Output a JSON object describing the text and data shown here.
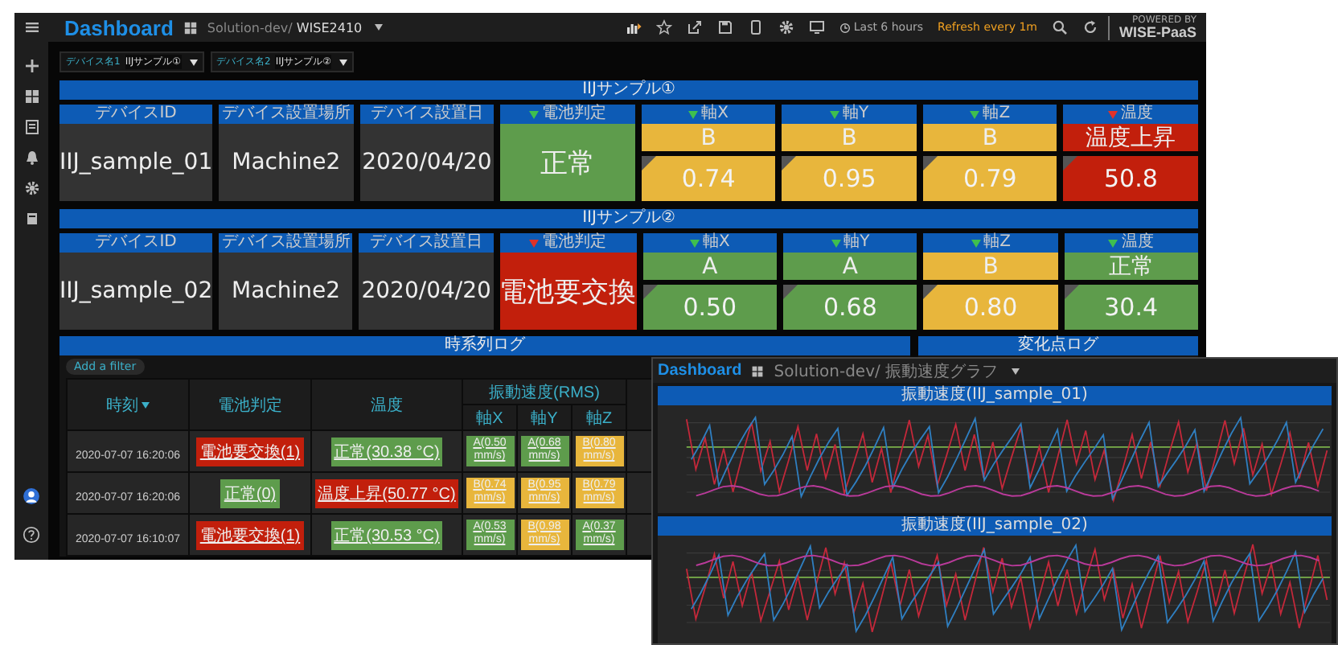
{
  "main": {
    "topbar": {
      "title": "Dashboard",
      "folder": "Solution-dev/",
      "name": "WISE2410",
      "time_range": "Last 6 hours",
      "refresh": "Refresh every 1m",
      "powered_by": "POWERED BY",
      "brand": "WISE-PaaS"
    },
    "variables": [
      {
        "label": "デバイス名1",
        "value": "IIJサンプル①"
      },
      {
        "label": "デバイス名2",
        "value": "IIJサンプル②"
      }
    ],
    "devices": [
      {
        "title": "IIJサンプル①",
        "fields": [
          {
            "label": "デバイスID",
            "value": "IIJ_sample_01"
          },
          {
            "label": "デバイス設置場所",
            "value": "Machine2"
          },
          {
            "label": "デバイス設置日",
            "value": "2020/04/20"
          }
        ],
        "battery": {
          "label": "電池判定",
          "value": "正常",
          "color": "#5e9c4c",
          "alert": false
        },
        "axes": [
          {
            "label": "軸X",
            "alert": false,
            "grade": {
              "text": "B",
              "color": "#e8b63c"
            },
            "reading": {
              "text": "0.74",
              "color": "#e8b63c"
            }
          },
          {
            "label": "軸Y",
            "alert": false,
            "grade": {
              "text": "B",
              "color": "#e8b63c"
            },
            "reading": {
              "text": "0.95",
              "color": "#e8b63c"
            }
          },
          {
            "label": "軸Z",
            "alert": false,
            "grade": {
              "text": "B",
              "color": "#e8b63c"
            },
            "reading": {
              "text": "0.79",
              "color": "#e8b63c"
            }
          },
          {
            "label": "温度",
            "alert": true,
            "grade": {
              "text": "温度上昇",
              "color": "#c21f0c"
            },
            "reading": {
              "text": "50.8",
              "color": "#c21f0c"
            }
          }
        ]
      },
      {
        "title": "IIJサンプル②",
        "fields": [
          {
            "label": "デバイスID",
            "value": "IIJ_sample_02"
          },
          {
            "label": "デバイス設置場所",
            "value": "Machine2"
          },
          {
            "label": "デバイス設置日",
            "value": "2020/04/20"
          }
        ],
        "battery": {
          "label": "電池判定",
          "value": "電池要交換",
          "color": "#c21f0c",
          "alert": true
        },
        "axes": [
          {
            "label": "軸X",
            "alert": false,
            "grade": {
              "text": "A",
              "color": "#5e9c4c"
            },
            "reading": {
              "text": "0.50",
              "color": "#5e9c4c"
            }
          },
          {
            "label": "軸Y",
            "alert": false,
            "grade": {
              "text": "A",
              "color": "#5e9c4c"
            },
            "reading": {
              "text": "0.68",
              "color": "#5e9c4c"
            }
          },
          {
            "label": "軸Z",
            "alert": false,
            "grade": {
              "text": "B",
              "color": "#e8b63c"
            },
            "reading": {
              "text": "0.80",
              "color": "#e8b63c"
            }
          },
          {
            "label": "温度",
            "alert": false,
            "grade": {
              "text": "正常",
              "color": "#5e9c4c"
            },
            "reading": {
              "text": "30.4",
              "color": "#5e9c4c"
            }
          }
        ]
      }
    ],
    "log": {
      "title": "時系列ログ",
      "filter_button": "Add a filter",
      "columns": {
        "time": "時刻",
        "battery": "電池判定",
        "temp": "温度",
        "group": "振動速度(RMS)",
        "axes": [
          "軸X",
          "軸Y",
          "軸Z"
        ]
      },
      "rows": [
        {
          "time": "2020-07-07 16:20:06",
          "cells": [
            {
              "text": "電池要交換(1)",
              "color": "#c21f0c"
            },
            {
              "text": "正常(30.38 °C)",
              "color": "#5e9c4c"
            },
            {
              "text": "A(0.50 mm/s)",
              "color": "#5e9c4c"
            },
            {
              "text": "A(0.68 mm/s)",
              "color": "#5e9c4c"
            },
            {
              "text": "B(0.80 mm/s)",
              "color": "#e8b63c"
            }
          ]
        },
        {
          "time": "2020-07-07 16:20:06",
          "cells": [
            {
              "text": "正常(0)",
              "color": "#5e9c4c"
            },
            {
              "text": "温度上昇(50.77 °C)",
              "color": "#c21f0c"
            },
            {
              "text": "B(0.74 mm/s)",
              "color": "#e8b63c"
            },
            {
              "text": "B(0.95 mm/s)",
              "color": "#e8b63c"
            },
            {
              "text": "B(0.79 mm/s)",
              "color": "#e8b63c"
            }
          ]
        },
        {
          "time": "2020-07-07 16:10:07",
          "cells": [
            {
              "text": "電池要交換(1)",
              "color": "#c21f0c"
            },
            {
              "text": "正常(30.53 °C)",
              "color": "#5e9c4c"
            },
            {
              "text": "A(0.53 mm/s)",
              "color": "#5e9c4c"
            },
            {
              "text": "B(0.98 mm/s)",
              "color": "#e8b63c"
            },
            {
              "text": "A(0.37 mm/s)",
              "color": "#5e9c4c"
            }
          ]
        }
      ]
    },
    "change_log": {
      "title": "変化点ログ"
    }
  },
  "overlay": {
    "title": "Dashboard",
    "breadcrumb": "Solution-dev/ 振動速度グラフ",
    "charts": [
      {
        "title": "振動速度(IIJ_sample_01)"
      },
      {
        "title": "振動速度(IIJ_sample_02)"
      }
    ]
  }
}
